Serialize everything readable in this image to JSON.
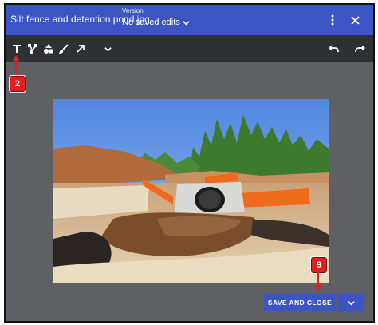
{
  "header": {
    "title": "Silt fence and detention pond.jpg",
    "version_label": "Version",
    "version_value": "No saved edits",
    "icons": [
      "chevron-down-icon",
      "more-vert-icon",
      "close-icon"
    ]
  },
  "toolbar": {
    "tools": [
      "text-icon",
      "vector-path-icon",
      "shapes-icon",
      "brush-icon",
      "arrow-icon",
      "chevron-down-icon"
    ],
    "actions": [
      "undo-icon",
      "redo-icon"
    ]
  },
  "markers": {
    "step_a": "2",
    "step_b": "9"
  },
  "footer": {
    "save_label": "SAVE AND CLOSE"
  },
  "colors": {
    "header": "#3d55c4",
    "toolbar": "#2f3033",
    "canvas": "#5f6064",
    "marker": "#e02020"
  }
}
